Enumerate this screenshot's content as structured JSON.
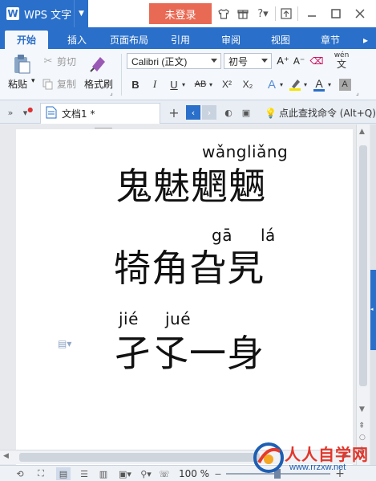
{
  "app": {
    "name": "WPS 文字",
    "logo": "W",
    "login": "未登录"
  },
  "tabs": [
    "开始",
    "插入",
    "页面布局",
    "引用",
    "审阅",
    "视图",
    "章节"
  ],
  "ribbon": {
    "paste": "粘贴",
    "cut": "剪切",
    "copy": "复制",
    "format_painter": "格式刷",
    "font_name": "Calibri (正文)",
    "font_size": "初号",
    "bold": "B",
    "italic": "I",
    "underline": "U",
    "strike": "AB",
    "superscript": "X²",
    "subscript": "X₂",
    "font_color": "A",
    "grow": "A⁺",
    "shrink": "A⁻",
    "pinyin_guide": "wén",
    "pinyin_guide_sub": "文"
  },
  "doc_tab": {
    "name": "文档1 *"
  },
  "search_hint": "点此查找命令 (Alt+Q)",
  "document": {
    "line1": {
      "pinyin": "wǎngliǎng",
      "chars": "鬼魅魍魉"
    },
    "line2": {
      "pinyin_a": "gā",
      "pinyin_b": "lá",
      "chars": "犄角旮旯"
    },
    "line3": {
      "pinyin_a": "jié",
      "pinyin_b": "jué",
      "chars": "孑孓一身"
    }
  },
  "status": {
    "zoom": "100 %"
  },
  "watermark": {
    "title": "人人自学网",
    "url": "www.rrzxw.net"
  },
  "colors": {
    "brand": "#2a6fc9",
    "login": "#e86a55"
  }
}
